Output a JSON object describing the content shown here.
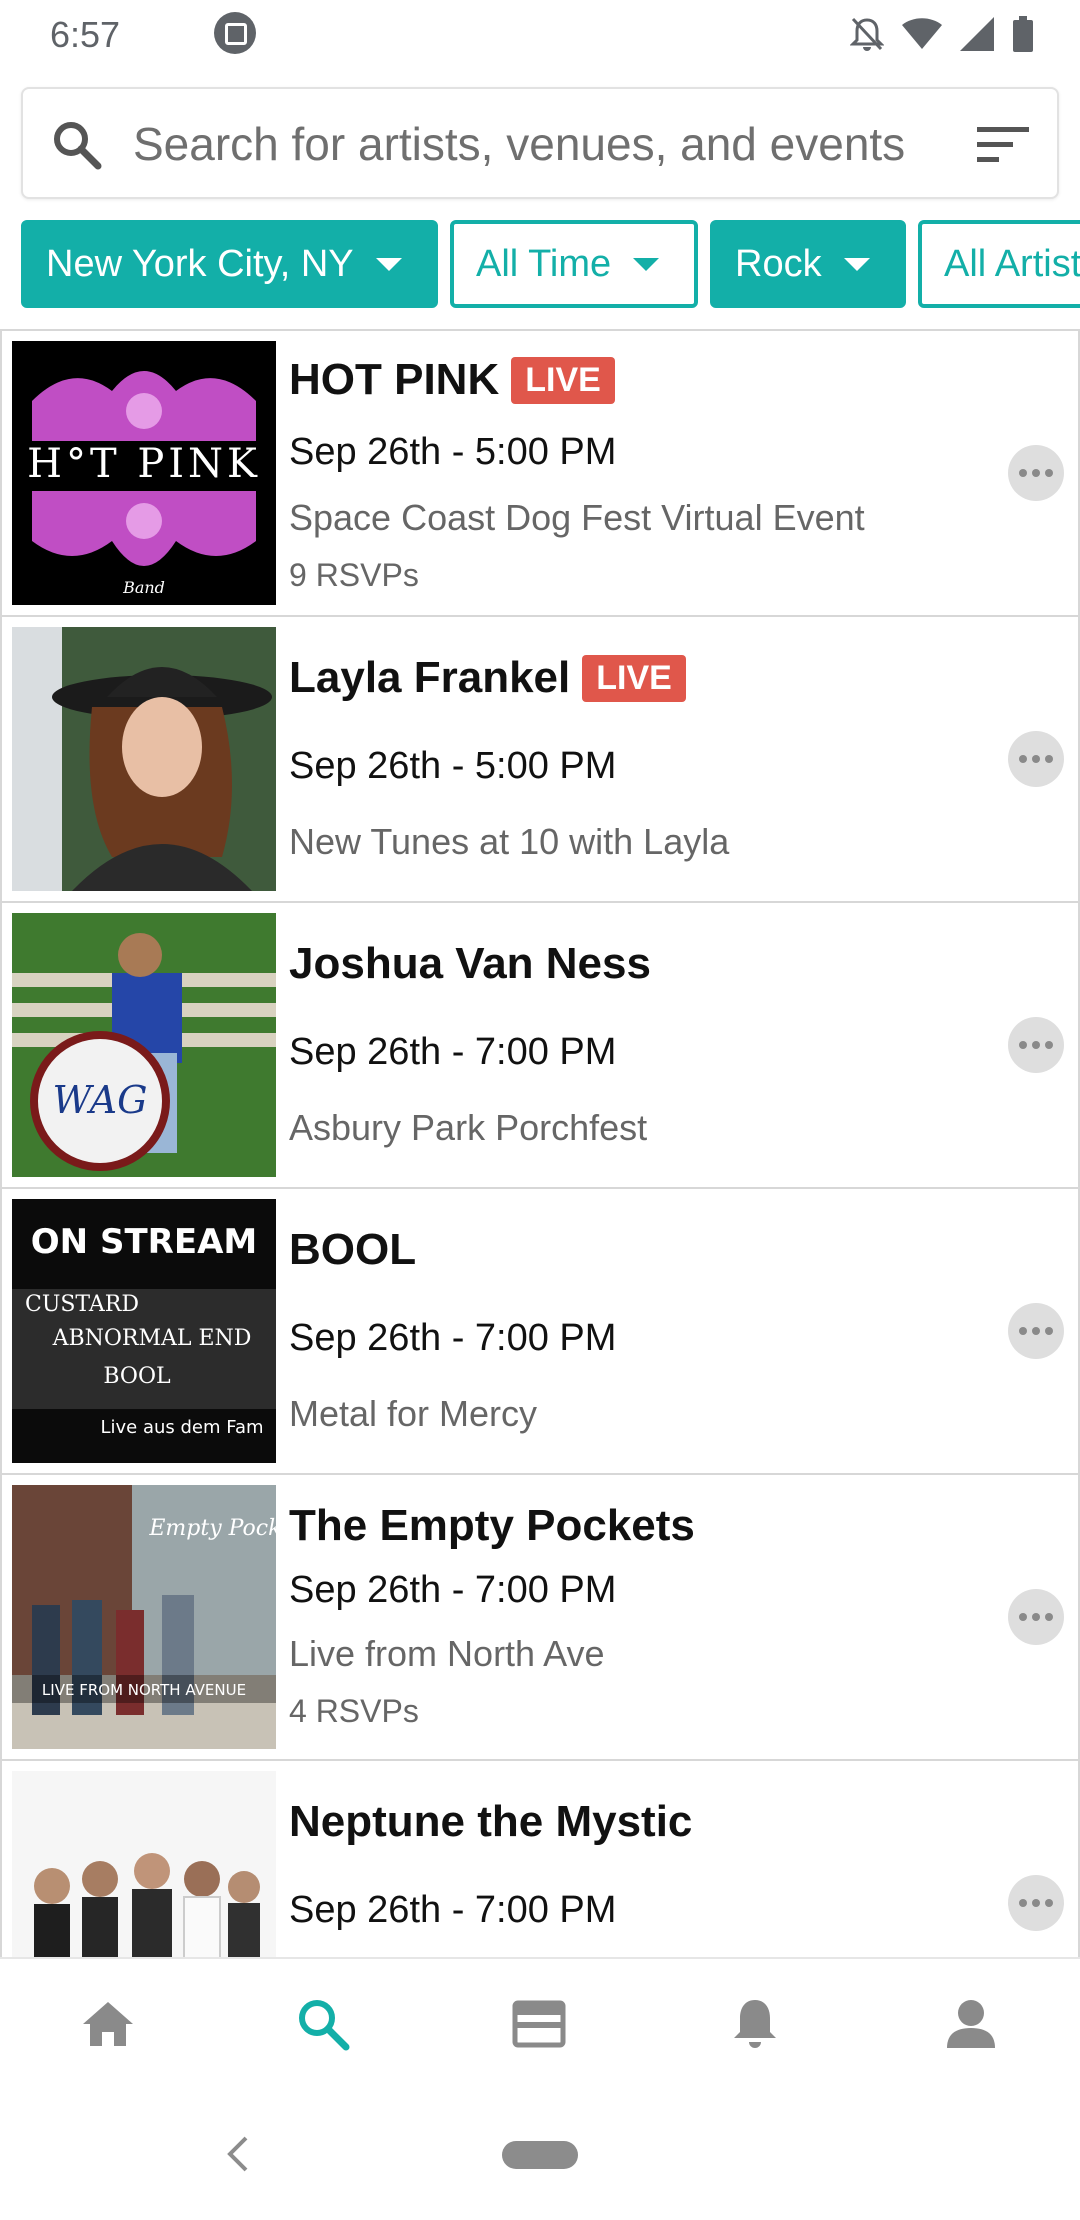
{
  "status_bar": {
    "time": "6:57",
    "icons": [
      "app-notification-icon",
      "do-not-disturb-bell-icon",
      "wifi-icon",
      "cell-signal-icon",
      "battery-icon"
    ]
  },
  "search": {
    "placeholder": "Search for artists, venues, and events",
    "icon": "search-icon",
    "sort_icon": "sort-icon"
  },
  "filters": [
    {
      "label": "New York City, NY",
      "style": "filled"
    },
    {
      "label": "All Time",
      "style": "outline"
    },
    {
      "label": "Rock",
      "style": "filled"
    },
    {
      "label": "All Artists",
      "style": "outline"
    }
  ],
  "events": [
    {
      "title": "HOT PINK",
      "live": "LIVE",
      "date": "Sep 26th - 5:00 PM",
      "venue": "Space Coast Dog Fest Virtual Event",
      "rsvps": "9 RSVPs",
      "thumb_text": "H°T PINK",
      "thumb_sub": "Band"
    },
    {
      "title": "Layla Frankel",
      "live": "LIVE",
      "date": "Sep 26th - 5:00 PM",
      "venue": "New Tunes at 10 with Layla",
      "rsvps": ""
    },
    {
      "title": "Joshua Van Ness",
      "live": "",
      "date": "Sep 26th - 7:00 PM",
      "venue": "Asbury Park Porchfest",
      "rsvps": "",
      "thumb_text": "WAG"
    },
    {
      "title": "BOOL",
      "live": "",
      "date": "Sep 26th - 7:00 PM",
      "venue": "Metal for Mercy",
      "rsvps": "",
      "thumb_text": "ON STREAM",
      "thumb_lines": [
        "CUSTARD",
        "ABNORMAL END",
        "BOOL",
        "Live aus dem Fam"
      ]
    },
    {
      "title": "The Empty Pockets",
      "live": "",
      "date": "Sep 26th - 7:00 PM",
      "venue": "Live from North Ave",
      "rsvps": "4 RSVPs",
      "thumb_text": "LIVE FROM NORTH AVENUE",
      "thumb_sub": "Empty Pockets"
    },
    {
      "title": "Neptune the Mystic",
      "live": "",
      "date": "Sep 26th - 7:00 PM",
      "venue": "",
      "rsvps": ""
    }
  ],
  "bottom_nav": [
    {
      "name": "home-icon",
      "active": false
    },
    {
      "name": "search-icon",
      "active": true
    },
    {
      "name": "tickets-icon",
      "active": false
    },
    {
      "name": "bell-icon",
      "active": false
    },
    {
      "name": "profile-icon",
      "active": false
    }
  ],
  "colors": {
    "accent": "#13afa8",
    "live_badge": "#e0574b",
    "inactive_icon": "#8a8a8a"
  }
}
